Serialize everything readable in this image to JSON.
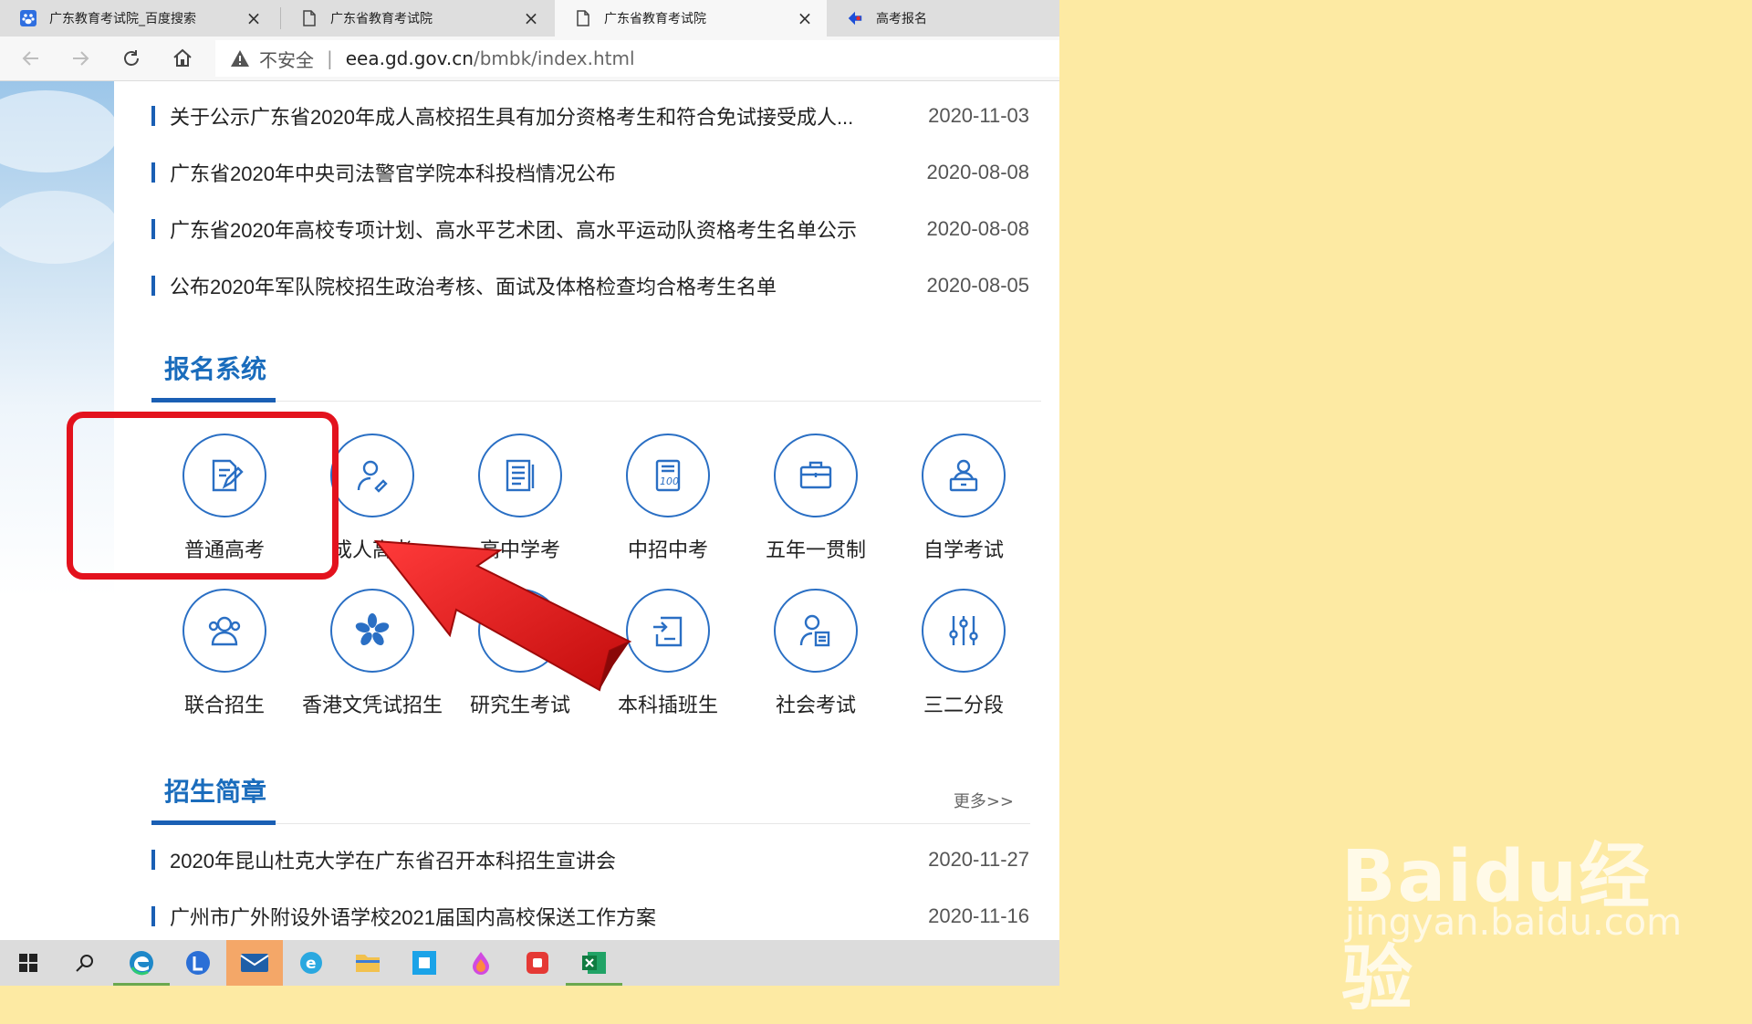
{
  "tabs": [
    {
      "label": "广东教育考试院_百度搜索",
      "icon": "baidu-paw-icon"
    },
    {
      "label": "广东省教育考试院",
      "icon": "page-icon"
    },
    {
      "label": "广东省教育考试院",
      "icon": "page-icon",
      "active": true
    },
    {
      "label": "高考报名",
      "icon": "blue-arrow-icon"
    }
  ],
  "address": {
    "security": "不安全",
    "host": "eea.gd.gov.cn",
    "path": "/bmbk/index.html"
  },
  "news": [
    {
      "title": "关于公示广东省2020年成人高校招生具有加分资格考生和符合免试接受成人...",
      "date": "2020-11-03"
    },
    {
      "title": "广东省2020年中央司法警官学院本科投档情况公布",
      "date": "2020-08-08"
    },
    {
      "title": "广东省2020年高校专项计划、高水平艺术团、高水平运动队资格考生名单公示",
      "date": "2020-08-08"
    },
    {
      "title": "公布2020年军队院校招生政治考核、面试及体格检查均合格考生名单",
      "date": "2020-08-05"
    }
  ],
  "registration": {
    "title": "报名系统",
    "items": [
      {
        "label": "普通高考",
        "icon": "exam-edit-icon"
      },
      {
        "label": "成人高考",
        "icon": "adult-person-icon"
      },
      {
        "label": "高中学考",
        "icon": "document-lines-icon"
      },
      {
        "label": "中招中考",
        "icon": "score-100-icon"
      },
      {
        "label": "五年一贯制",
        "icon": "briefcase-icon"
      },
      {
        "label": "自学考试",
        "icon": "self-study-icon"
      },
      {
        "label": "联合招生",
        "icon": "group-people-icon"
      },
      {
        "label": "香港文凭试招生",
        "icon": "bauhinia-flower-icon"
      },
      {
        "label": "研究生考试",
        "icon": "graduate-icon"
      },
      {
        "label": "本科插班生",
        "icon": "transfer-doc-icon"
      },
      {
        "label": "社会考试",
        "icon": "person-doc-icon"
      },
      {
        "label": "三二分段",
        "icon": "sliders-icon"
      }
    ]
  },
  "admissions": {
    "title": "招生简章",
    "more": "更多>>",
    "items": [
      {
        "title": "2020年昆山杜克大学在广东省召开本科招生宣讲会",
        "date": "2020-11-27"
      },
      {
        "title": "广州市广外附设外语学校2021届国内高校保送工作方案",
        "date": "2020-11-16"
      }
    ]
  },
  "taskbar": [
    "windows-start-icon",
    "search-icon",
    "edge-icon",
    "l-app-icon",
    "mail-icon",
    "ie-icon",
    "file-explorer-icon",
    "blue-app-icon",
    "paint-drop-icon",
    "red-record-icon",
    "excel-icon"
  ],
  "watermark": {
    "line1": "Baidu经验",
    "line2": "jingyan.baidu.com"
  },
  "colors": {
    "accent": "#1a5fb4",
    "highlight": "#e3121d",
    "background": "#fdeaa3"
  }
}
